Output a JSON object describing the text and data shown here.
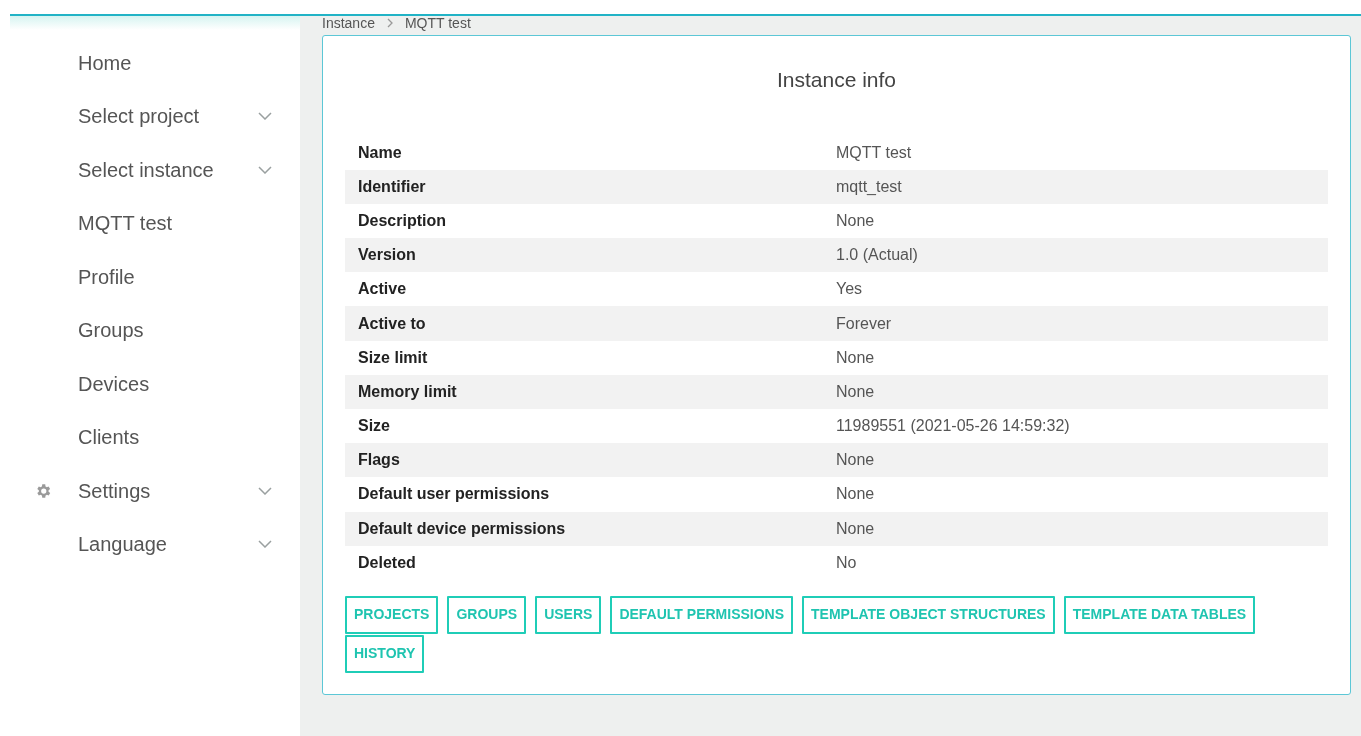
{
  "sidebar": {
    "items": [
      {
        "label": "Home",
        "kind": "link"
      },
      {
        "label": "Select project",
        "kind": "menu"
      },
      {
        "label": "Select instance",
        "kind": "menu"
      },
      {
        "label": "MQTT test",
        "kind": "link"
      },
      {
        "label": "Profile",
        "kind": "link"
      },
      {
        "label": "Groups",
        "kind": "link"
      },
      {
        "label": "Devices",
        "kind": "link"
      },
      {
        "label": "Clients",
        "kind": "link"
      },
      {
        "label": "Settings",
        "kind": "settings_menu"
      },
      {
        "label": "Language",
        "kind": "menu"
      }
    ]
  },
  "breadcrumb": [
    "Instance",
    "MQTT test"
  ],
  "card": {
    "title": "Instance info",
    "rows": [
      {
        "label": "Name",
        "value": "MQTT test"
      },
      {
        "label": "Identifier",
        "value": "mqtt_test"
      },
      {
        "label": "Description",
        "value": "None"
      },
      {
        "label": "Version",
        "value": "1.0 (Actual)"
      },
      {
        "label": "Active",
        "value": "Yes"
      },
      {
        "label": "Active to",
        "value": "Forever"
      },
      {
        "label": "Size limit",
        "value": "None"
      },
      {
        "label": "Memory limit",
        "value": "None"
      },
      {
        "label": "Size",
        "value": "11989551 (2021-05-26 14:59:32)"
      },
      {
        "label": "Flags",
        "value": "None"
      },
      {
        "label": "Default user permissions",
        "value": "None"
      },
      {
        "label": "Default device permissions",
        "value": "None"
      },
      {
        "label": "Deleted",
        "value": "No"
      }
    ],
    "buttons": [
      "PROJECTS",
      "GROUPS",
      "USERS",
      "DEFAULT PERMISSIONS",
      "TEMPLATE OBJECT STRUCTURES",
      "TEMPLATE DATA TABLES",
      "HISTORY"
    ]
  }
}
